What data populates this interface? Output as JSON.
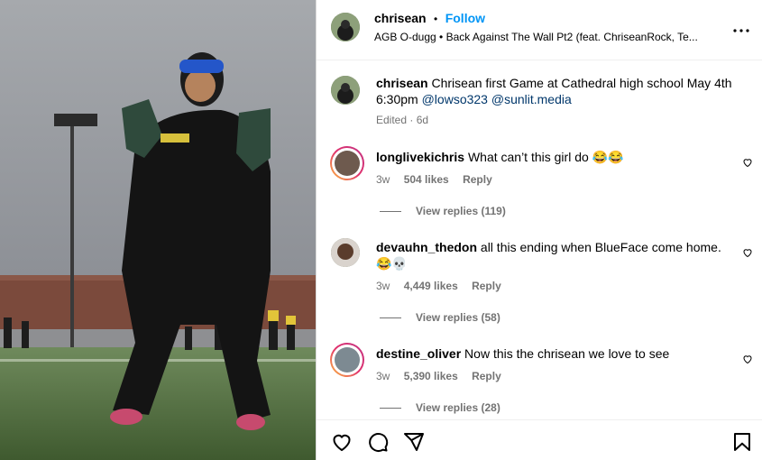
{
  "post": {
    "username": "chrisean",
    "follow_label": "Follow",
    "separator": "•",
    "audio": "AGB O-dugg • Back Against The Wall Pt2 (feat. ChriseanRock, Te...",
    "caption_user": "chrisean",
    "caption_text": "Chrisean first Game at Cathedral high school May 4th 6:30pm",
    "mention_1": "@lowso323",
    "mention_2": "@sunlit.media",
    "edited": "Edited · 6d"
  },
  "comments": [
    {
      "user": "longlivekichris",
      "text": "What can’t this girl do 😂😂",
      "time": "3w",
      "likes": "504 likes",
      "reply": "Reply",
      "view_replies": "View replies (119)"
    },
    {
      "user": "devauhn_thedon",
      "text": "all this ending when BlueFace come home.",
      "text2": "😂💀",
      "time": "3w",
      "likes": "4,449 likes",
      "reply": "Reply",
      "view_replies": "View replies (58)"
    },
    {
      "user": "destine_oliver",
      "text": "Now this the chrisean we love to see",
      "time": "3w",
      "likes": "5,390 likes",
      "reply": "Reply",
      "view_replies": "View replies (28)"
    }
  ],
  "icons": {
    "more": "more-options-icon",
    "like": "heart-icon",
    "comment": "comment-icon",
    "share": "share-icon",
    "save": "bookmark-icon"
  },
  "colors": {
    "accent": "#0095f6",
    "muted": "#737373",
    "link": "#00376b"
  }
}
